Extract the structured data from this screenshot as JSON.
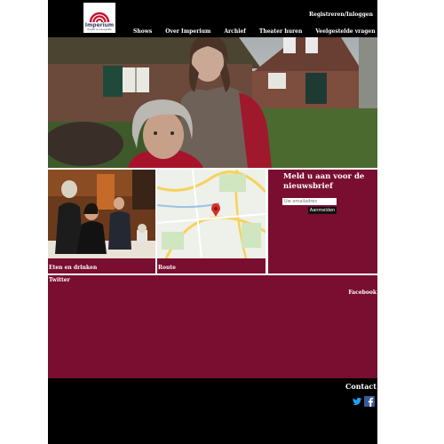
{
  "brand": {
    "logo_word": "Imperium",
    "logo_tagline": "theater & scenografie"
  },
  "header": {
    "login_label": "Registreren/Inloggen",
    "nav": [
      "Shows",
      "Over Imperium",
      "Archief",
      "Theater huren",
      "Veelgestelde vragen"
    ]
  },
  "tiles": {
    "food_caption": "Eten en drinken",
    "route_caption": "Route"
  },
  "newsletter": {
    "title": "Meld u aan voor de nieuwsbrief",
    "email_placeholder": "Uw emailadres",
    "submit_label": "Aanmelden"
  },
  "social": {
    "twitter_label": "Twitter",
    "facebook_label": "Facebook"
  },
  "footer": {
    "contact_label": "Contact"
  },
  "icons": [
    "twitter-icon",
    "facebook-icon"
  ],
  "colors": {
    "brand": "#7a0e30",
    "background": "#000000",
    "page": "#ffffff"
  }
}
